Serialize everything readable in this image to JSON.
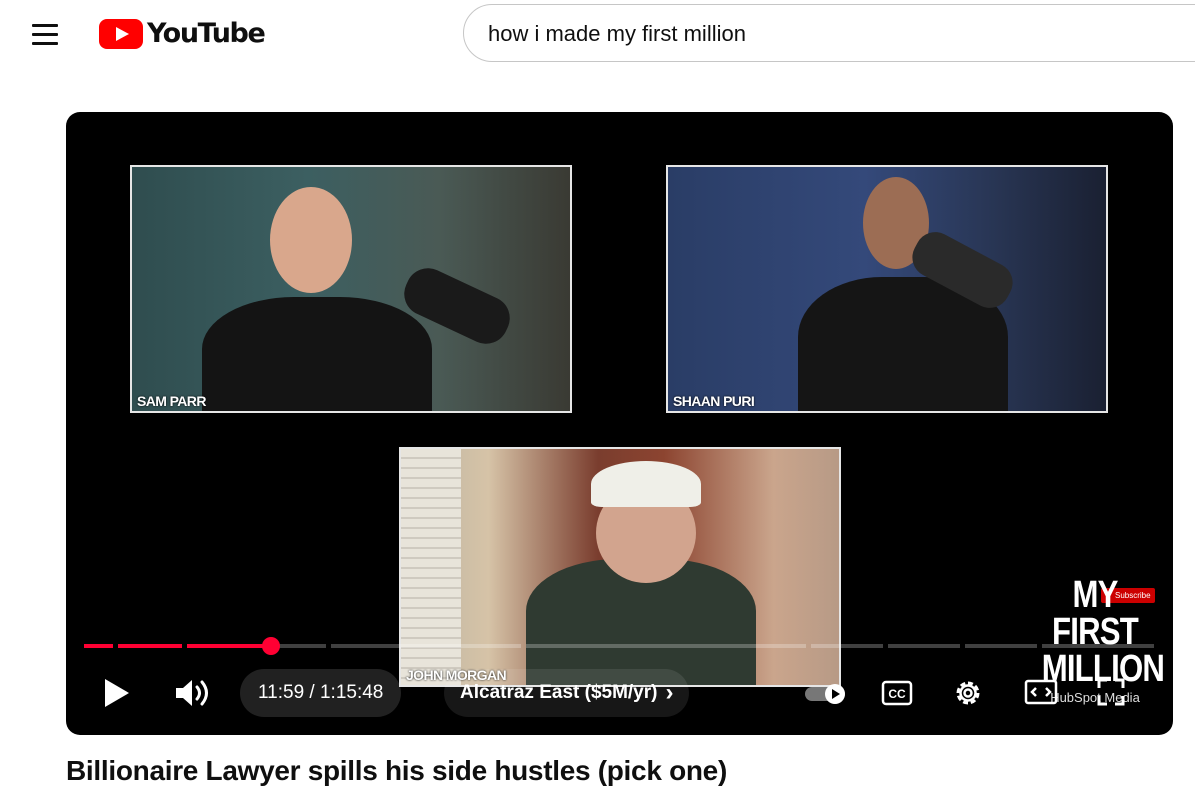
{
  "header": {
    "logo_text": "YouTube",
    "search_query": "how i made my first million"
  },
  "video": {
    "participants": [
      "SAM PARR",
      "SHAAN PURI",
      "JOHN MORGAN"
    ],
    "brand_lines": [
      "MY",
      "FIRST",
      "MILLION"
    ],
    "brand_sub": "HubSpot Media",
    "subscribe_chip": "Subscribe",
    "progress_fraction": 0.159,
    "time_current": "11:59",
    "time_separator": " / ",
    "time_total": "1:15:48",
    "chapter": "Alcatraz East ($5M/yr)",
    "chapter_chevron": "›"
  },
  "title": "Billionaire Lawyer spills his side hustles (pick one)",
  "icons": [
    "menu-icon",
    "youtube-logo-icon",
    "play-icon",
    "volume-icon",
    "chevron-right-icon",
    "autoplay-toggle-icon",
    "captions-icon",
    "settings-icon",
    "theater-mode-icon",
    "fullscreen-icon"
  ],
  "colors": {
    "brand_red": "#ff0000",
    "progress_red": "#ff0033",
    "player_bg": "#000000"
  }
}
